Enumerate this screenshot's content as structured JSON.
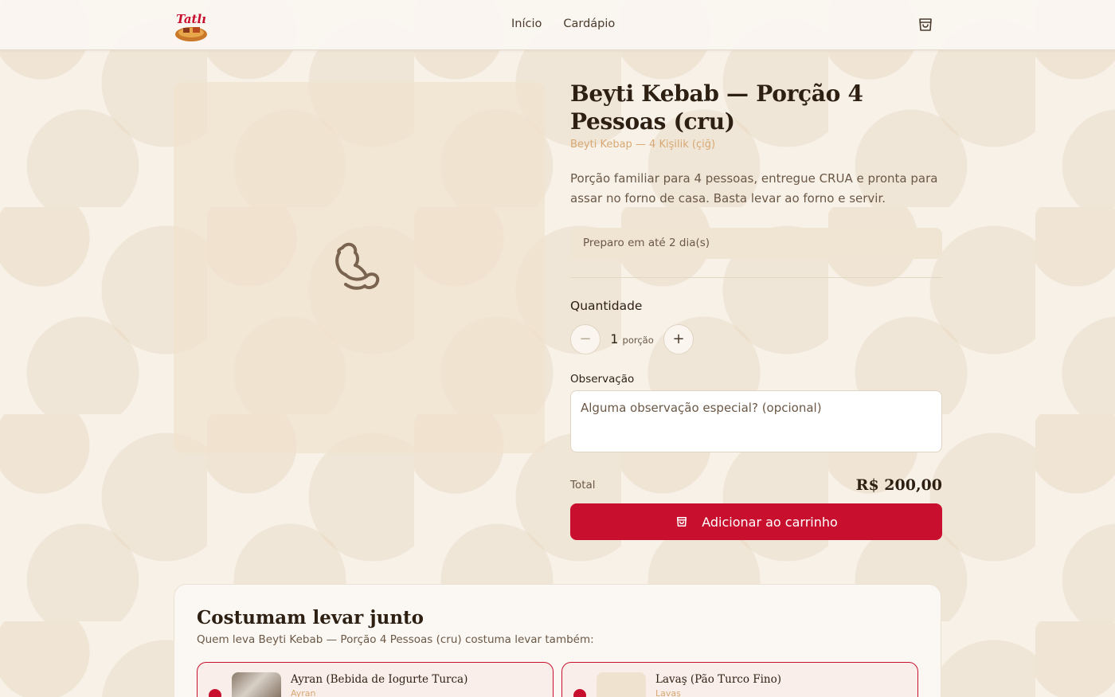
{
  "header": {
    "logo_text": "Tatlı",
    "nav": [
      "Início",
      "Cardápio"
    ]
  },
  "product": {
    "title": "Beyti Kebab — Porção 4 Pessoas (cru)",
    "subtitle": "Beyti Kebap — 4 Kişilik (çiğ)",
    "description": "Porção familiar para 4 pessoas, entregue CRUA e pronta para assar no forno de casa. Basta levar ao forno e servir.",
    "prep_time": "Preparo em até 2 dia(s)",
    "image_icon": "croissant-icon",
    "quantity_label": "Quantidade",
    "quantity_value": "1",
    "quantity_unit": "porção",
    "observation_label": "Observação",
    "observation_placeholder": "Alguma observação especial? (opcional)",
    "total_label": "Total",
    "total_value": "R$ 200,00",
    "add_button": "Adicionar ao carrinho"
  },
  "together": {
    "title": "Costumam levar junto",
    "subtitle": "Quem leva Beyti Kebab — Porção 4 Pessoas (cru) costuma levar também:",
    "items": [
      {
        "name": "Ayran (Bebida de Iogurte Turca)",
        "sub": "Ayran"
      },
      {
        "name": "Lavaş (Pão Turco Fino)",
        "sub": "Lavaş"
      }
    ]
  },
  "colors": {
    "accent": "#c8102e",
    "background": "#f7f1e8",
    "muted_gold": "#d7a873"
  }
}
